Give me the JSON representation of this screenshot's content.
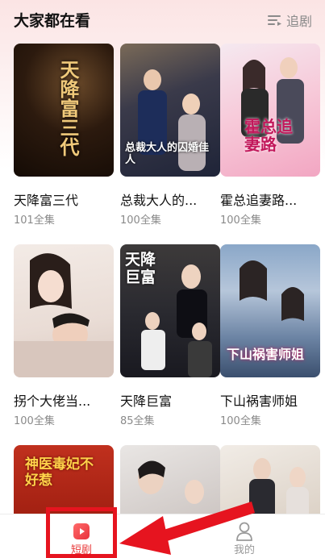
{
  "header": {
    "title": "大家都在看",
    "follow_label": "追剧"
  },
  "dramas": [
    {
      "title": "天降富三代",
      "episodes": "101全集",
      "poster_text": "天降富三代"
    },
    {
      "title": "总裁大人的...",
      "episodes": "100全集",
      "poster_text": "总裁大人的囚婚佳人"
    },
    {
      "title": "霍总追妻路...",
      "episodes": "100全集",
      "poster_text": "霍总追妻路"
    },
    {
      "title": "拐个大佬当...",
      "episodes": "100全集",
      "poster_text": ""
    },
    {
      "title": "天降巨富",
      "episodes": "85全集",
      "poster_text": "天降巨富"
    },
    {
      "title": "下山祸害师姐",
      "episodes": "100全集",
      "poster_text": "下山祸害师姐"
    },
    {
      "title": "",
      "episodes": "",
      "poster_text": "神医毒妃不好惹"
    },
    {
      "title": "",
      "episodes": "",
      "poster_text": ""
    },
    {
      "title": "",
      "episodes": "",
      "poster_text": ""
    }
  ],
  "tabbar": {
    "tabs": [
      {
        "label": "短剧",
        "icon": "play-square-icon",
        "active": true
      },
      {
        "label": "我的",
        "icon": "person-icon",
        "active": false
      }
    ]
  },
  "colors": {
    "accent": "#e93a3a",
    "annotation": "#e6141f"
  }
}
